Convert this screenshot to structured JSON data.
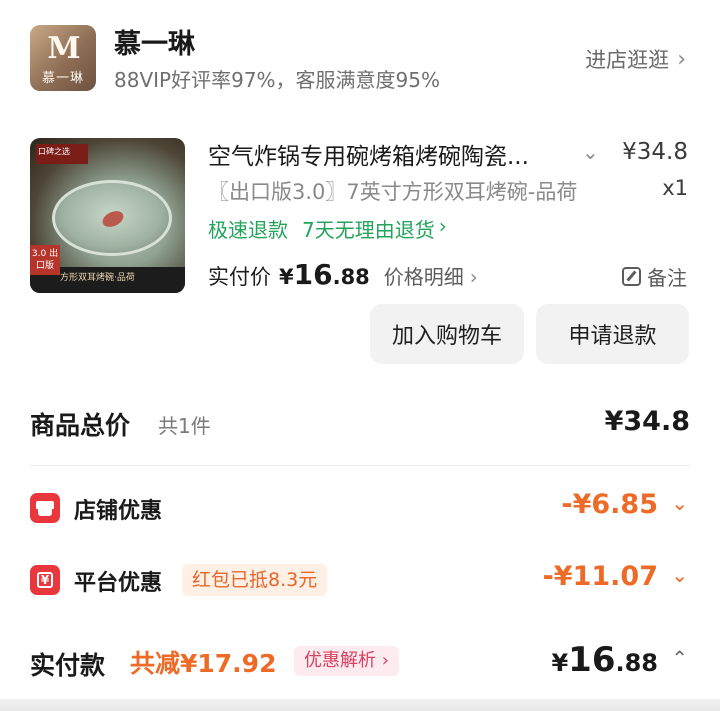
{
  "store": {
    "logo_letter": "M",
    "logo_text": "慕一琳",
    "name": "慕一琳",
    "rating": "88VIP好评率97%，客服满意度95%",
    "enter_label": "进店逛逛",
    "chevron": "›"
  },
  "product": {
    "image_badge": "3.0 出口版",
    "image_caption": "方形双耳烤碗·品荷",
    "image_tag": "口碑之选",
    "title": "空气炸锅专用碗烤箱烤碗陶瓷...",
    "price": "¥34.8",
    "spec": "〖出口版3.0〗7英寸方形双耳烤碗-品荷",
    "quantity": "x1",
    "service_fast_refund": "极速退款",
    "service_return": "7天无理由退货",
    "paid_label": "实付价",
    "paid_yen": "¥",
    "paid_int": "16",
    "paid_dec": ".88",
    "price_detail_label": "价格明细",
    "remark_label": "备注",
    "add_cart_label": "加入购物车",
    "refund_label": "申请退款"
  },
  "summary": {
    "total_label": "商品总价",
    "total_count": "共1件",
    "total_value": "¥34.8",
    "shop_discount_label": "店铺优惠",
    "shop_discount_value": "-¥6.85",
    "platform_discount_label": "平台优惠",
    "red_packet_label": "红包已抵8.3元",
    "platform_discount_value": "-¥11.07",
    "pay_label": "实付款",
    "pay_saved": "共减¥17.92",
    "pay_analysis": "优惠解析 ›",
    "pay_yen": "¥",
    "pay_int": "16",
    "pay_dec": ".88"
  },
  "icons": {
    "chevron_down": "⌄",
    "chevron_up": "⌃",
    "chevron_right": "›",
    "shop": "shop-icon",
    "ticket": "ticket-icon",
    "edit": "edit-icon"
  },
  "colors": {
    "green": "#23a35b",
    "orange": "#ed6b26",
    "red_icon": "#e8373d",
    "button_bg": "#f2f2f2"
  }
}
